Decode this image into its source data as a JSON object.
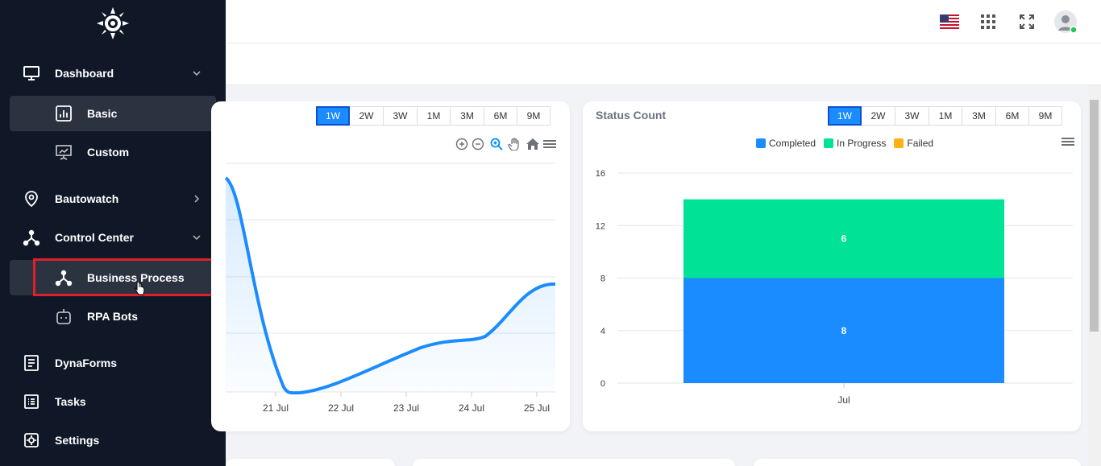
{
  "sidebar": {
    "items": [
      {
        "label": "Dashboard",
        "icon": "monitor-icon",
        "chevron": "down"
      },
      {
        "label": "Bautowatch",
        "icon": "location-pin-icon",
        "chevron": "right"
      },
      {
        "label": "Control Center",
        "icon": "network-icon",
        "chevron": "down"
      },
      {
        "label": "DynaForms",
        "icon": "form-icon"
      },
      {
        "label": "Tasks",
        "icon": "task-list-icon"
      },
      {
        "label": "Settings",
        "icon": "settings-icon"
      }
    ],
    "dashboard_sub": [
      {
        "label": "Basic",
        "icon": "bar-chart-icon",
        "active": true
      },
      {
        "label": "Custom",
        "icon": "presentation-icon"
      }
    ],
    "control_center_sub": [
      {
        "label": "Business Process",
        "icon": "network-icon",
        "active": true
      },
      {
        "label": "RPA Bots",
        "icon": "robot-icon"
      }
    ]
  },
  "left_chart": {
    "ranges": [
      "1W",
      "2W",
      "3W",
      "1M",
      "3M",
      "6M",
      "9M"
    ],
    "active_range": "1W",
    "chart_data": {
      "type": "area",
      "x": [
        "21 Jul",
        "22 Jul",
        "23 Jul",
        "24 Jul",
        "25 Jul"
      ],
      "series_color": "#1a8cff"
    }
  },
  "status_chart": {
    "title": "Status Count",
    "ranges": [
      "1W",
      "2W",
      "3W",
      "1M",
      "3M",
      "6M",
      "9M"
    ],
    "active_range": "1W",
    "chart_data": {
      "type": "bar",
      "stacked": true,
      "categories": [
        "Jul"
      ],
      "series": [
        {
          "name": "Completed",
          "values": [
            8
          ],
          "color": "#1a8cff"
        },
        {
          "name": "In Progress",
          "values": [
            6
          ],
          "color": "#00e396"
        },
        {
          "name": "Failed",
          "values": [
            0
          ],
          "color": "#feb019"
        }
      ],
      "yticks": [
        "0",
        "4",
        "8",
        "12",
        "16"
      ],
      "ylim": [
        0,
        16
      ]
    }
  }
}
